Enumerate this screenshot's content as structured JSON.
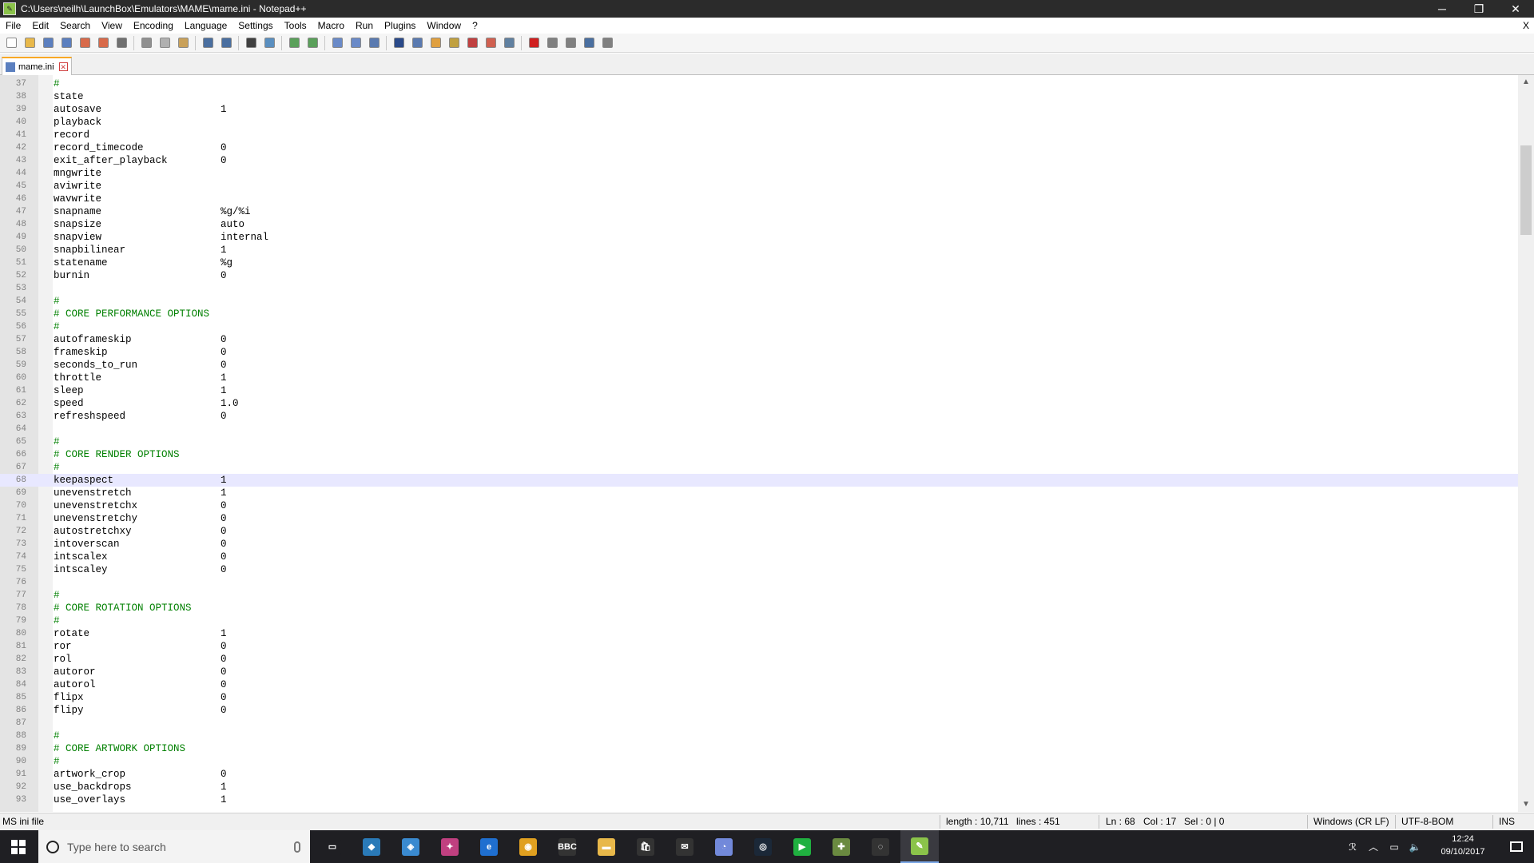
{
  "window": {
    "title": "C:\\Users\\neilh\\LaunchBox\\Emulators\\MAME\\mame.ini - Notepad++",
    "minimize": "─",
    "restore": "❐",
    "close": "✕"
  },
  "menu": {
    "items": [
      "File",
      "Edit",
      "Search",
      "View",
      "Encoding",
      "Language",
      "Settings",
      "Tools",
      "Macro",
      "Run",
      "Plugins",
      "Window",
      "?"
    ],
    "close_doc": "X"
  },
  "toolbar": {
    "buttons": [
      {
        "icon": "new-file-icon",
        "color": "#ffffff"
      },
      {
        "icon": "open-file-icon",
        "color": "#e8b84a"
      },
      {
        "icon": "save-icon",
        "color": "#5b7fbf"
      },
      {
        "icon": "save-all-icon",
        "color": "#5b7fbf"
      },
      {
        "icon": "close-icon",
        "color": "#d86a4a"
      },
      {
        "icon": "close-all-icon",
        "color": "#d86a4a"
      },
      {
        "icon": "print-icon",
        "color": "#707070"
      },
      {
        "icon": "cut-icon",
        "color": "#909090"
      },
      {
        "icon": "copy-icon",
        "color": "#b0b0b0"
      },
      {
        "icon": "paste-icon",
        "color": "#c9a15a"
      },
      {
        "icon": "undo-icon",
        "color": "#4a6fa0"
      },
      {
        "icon": "redo-icon",
        "color": "#4a6fa0"
      },
      {
        "icon": "find-icon",
        "color": "#404040"
      },
      {
        "icon": "replace-icon",
        "color": "#5a8fc0"
      },
      {
        "icon": "zoom-in-icon",
        "color": "#5aa05a"
      },
      {
        "icon": "zoom-out-icon",
        "color": "#5aa05a"
      },
      {
        "icon": "sync-vertical-icon",
        "color": "#6a8ac8"
      },
      {
        "icon": "sync-horizontal-icon",
        "color": "#6a8ac8"
      },
      {
        "icon": "word-wrap-icon",
        "color": "#5a7ab0"
      },
      {
        "icon": "show-all-chars-icon",
        "color": "#2a4a8a"
      },
      {
        "icon": "indent-guide-icon",
        "color": "#5a7ab0"
      },
      {
        "icon": "udl-icon",
        "color": "#e0a040"
      },
      {
        "icon": "doc-map-icon",
        "color": "#c0a040"
      },
      {
        "icon": "function-list-icon",
        "color": "#c04040"
      },
      {
        "icon": "folder-workspace-icon",
        "color": "#d06050"
      },
      {
        "icon": "monitoring-icon",
        "color": "#6080a0"
      },
      {
        "icon": "record-macro-icon",
        "color": "#d02020"
      },
      {
        "icon": "stop-macro-icon",
        "color": "#808080"
      },
      {
        "icon": "play-macro-icon",
        "color": "#808080"
      },
      {
        "icon": "run-macro-multiple-icon",
        "color": "#4a6fa0"
      },
      {
        "icon": "save-macro-icon",
        "color": "#808080"
      }
    ]
  },
  "tab": {
    "label": "mame.ini"
  },
  "editor": {
    "current_line": "68",
    "lines": [
      {
        "n": "37",
        "key": "",
        "value": "",
        "comment": "#"
      },
      {
        "n": "38",
        "key": "state",
        "value": "",
        "comment": ""
      },
      {
        "n": "39",
        "key": "autosave",
        "value": "1",
        "comment": ""
      },
      {
        "n": "40",
        "key": "playback",
        "value": "",
        "comment": ""
      },
      {
        "n": "41",
        "key": "record",
        "value": "",
        "comment": ""
      },
      {
        "n": "42",
        "key": "record_timecode",
        "value": "0",
        "comment": ""
      },
      {
        "n": "43",
        "key": "exit_after_playback",
        "value": "0",
        "comment": ""
      },
      {
        "n": "44",
        "key": "mngwrite",
        "value": "",
        "comment": ""
      },
      {
        "n": "45",
        "key": "aviwrite",
        "value": "",
        "comment": ""
      },
      {
        "n": "46",
        "key": "wavwrite",
        "value": "",
        "comment": ""
      },
      {
        "n": "47",
        "key": "snapname",
        "value": "%g/%i",
        "comment": ""
      },
      {
        "n": "48",
        "key": "snapsize",
        "value": "auto",
        "comment": ""
      },
      {
        "n": "49",
        "key": "snapview",
        "value": "internal",
        "comment": ""
      },
      {
        "n": "50",
        "key": "snapbilinear",
        "value": "1",
        "comment": ""
      },
      {
        "n": "51",
        "key": "statename",
        "value": "%g",
        "comment": ""
      },
      {
        "n": "52",
        "key": "burnin",
        "value": "0",
        "comment": ""
      },
      {
        "n": "53",
        "key": "",
        "value": "",
        "comment": ""
      },
      {
        "n": "54",
        "key": "",
        "value": "",
        "comment": "#"
      },
      {
        "n": "55",
        "key": "",
        "value": "",
        "comment": "# CORE PERFORMANCE OPTIONS"
      },
      {
        "n": "56",
        "key": "",
        "value": "",
        "comment": "#"
      },
      {
        "n": "57",
        "key": "autoframeskip",
        "value": "0",
        "comment": ""
      },
      {
        "n": "58",
        "key": "frameskip",
        "value": "0",
        "comment": ""
      },
      {
        "n": "59",
        "key": "seconds_to_run",
        "value": "0",
        "comment": ""
      },
      {
        "n": "60",
        "key": "throttle",
        "value": "1",
        "comment": ""
      },
      {
        "n": "61",
        "key": "sleep",
        "value": "1",
        "comment": ""
      },
      {
        "n": "62",
        "key": "speed",
        "value": "1.0",
        "comment": ""
      },
      {
        "n": "63",
        "key": "refreshspeed",
        "value": "0",
        "comment": ""
      },
      {
        "n": "64",
        "key": "",
        "value": "",
        "comment": ""
      },
      {
        "n": "65",
        "key": "",
        "value": "",
        "comment": "#"
      },
      {
        "n": "66",
        "key": "",
        "value": "",
        "comment": "# CORE RENDER OPTIONS"
      },
      {
        "n": "67",
        "key": "",
        "value": "",
        "comment": "#"
      },
      {
        "n": "68",
        "key": "keepaspect",
        "value": "1",
        "comment": ""
      },
      {
        "n": "69",
        "key": "unevenstretch",
        "value": "1",
        "comment": ""
      },
      {
        "n": "70",
        "key": "unevenstretchx",
        "value": "0",
        "comment": ""
      },
      {
        "n": "71",
        "key": "unevenstretchy",
        "value": "0",
        "comment": ""
      },
      {
        "n": "72",
        "key": "autostretchxy",
        "value": "0",
        "comment": ""
      },
      {
        "n": "73",
        "key": "intoverscan",
        "value": "0",
        "comment": ""
      },
      {
        "n": "74",
        "key": "intscalex",
        "value": "0",
        "comment": ""
      },
      {
        "n": "75",
        "key": "intscaley",
        "value": "0",
        "comment": ""
      },
      {
        "n": "76",
        "key": "",
        "value": "",
        "comment": ""
      },
      {
        "n": "77",
        "key": "",
        "value": "",
        "comment": "#"
      },
      {
        "n": "78",
        "key": "",
        "value": "",
        "comment": "# CORE ROTATION OPTIONS"
      },
      {
        "n": "79",
        "key": "",
        "value": "",
        "comment": "#"
      },
      {
        "n": "80",
        "key": "rotate",
        "value": "1",
        "comment": ""
      },
      {
        "n": "81",
        "key": "ror",
        "value": "0",
        "comment": ""
      },
      {
        "n": "82",
        "key": "rol",
        "value": "0",
        "comment": ""
      },
      {
        "n": "83",
        "key": "autoror",
        "value": "0",
        "comment": ""
      },
      {
        "n": "84",
        "key": "autorol",
        "value": "0",
        "comment": ""
      },
      {
        "n": "85",
        "key": "flipx",
        "value": "0",
        "comment": ""
      },
      {
        "n": "86",
        "key": "flipy",
        "value": "0",
        "comment": ""
      },
      {
        "n": "87",
        "key": "",
        "value": "",
        "comment": ""
      },
      {
        "n": "88",
        "key": "",
        "value": "",
        "comment": "#"
      },
      {
        "n": "89",
        "key": "",
        "value": "",
        "comment": "# CORE ARTWORK OPTIONS"
      },
      {
        "n": "90",
        "key": "",
        "value": "",
        "comment": "#"
      },
      {
        "n": "91",
        "key": "artwork_crop",
        "value": "0",
        "comment": ""
      },
      {
        "n": "92",
        "key": "use_backdrops",
        "value": "1",
        "comment": ""
      },
      {
        "n": "93",
        "key": "use_overlays",
        "value": "1",
        "comment": ""
      }
    ]
  },
  "status": {
    "file_type": "MS ini file",
    "length": "length : 10,711",
    "lines": "lines : 451",
    "ln": "Ln : 68",
    "col": "Col : 17",
    "sel": "Sel : 0 | 0",
    "eol": "Windows (CR LF)",
    "encoding": "UTF-8-BOM",
    "mode": "INS"
  },
  "taskbar": {
    "search_placeholder": "Type here to search",
    "apps": [
      {
        "name": "task-view-icon",
        "color": "#1f1f23",
        "label": "▭"
      },
      {
        "name": "kodi-icon",
        "color": "#2a7ab8",
        "label": "◆"
      },
      {
        "name": "launchbox-icon",
        "color": "#3a8ad0",
        "label": "◈"
      },
      {
        "name": "colorful-app-icon",
        "color": "#c04080",
        "label": "✦"
      },
      {
        "name": "edge-icon",
        "color": "#1f6fd0",
        "label": "e"
      },
      {
        "name": "chrome-icon",
        "color": "#e0a020",
        "label": "◉"
      },
      {
        "name": "bbc-icon",
        "color": "#333333",
        "label": "BBC"
      },
      {
        "name": "file-explorer-icon",
        "color": "#e8b84a",
        "label": "▬"
      },
      {
        "name": "store-icon",
        "color": "#333333",
        "label": "🛍"
      },
      {
        "name": "mail-icon",
        "color": "#333333",
        "label": "✉"
      },
      {
        "name": "discord-icon",
        "color": "#7289da",
        "label": "◔"
      },
      {
        "name": "steam-icon",
        "color": "#1b2838",
        "label": "◎"
      },
      {
        "name": "green-app-icon",
        "color": "#20b040",
        "label": "▶"
      },
      {
        "name": "controller-app-icon",
        "color": "#6a8a40",
        "label": "✚"
      },
      {
        "name": "gamepad-icon",
        "color": "#333333",
        "label": "◌"
      },
      {
        "name": "notepadpp-icon",
        "color": "#8bc34a",
        "label": "✎"
      }
    ],
    "clock_time": "12:24",
    "clock_date": "09/10/2017"
  }
}
